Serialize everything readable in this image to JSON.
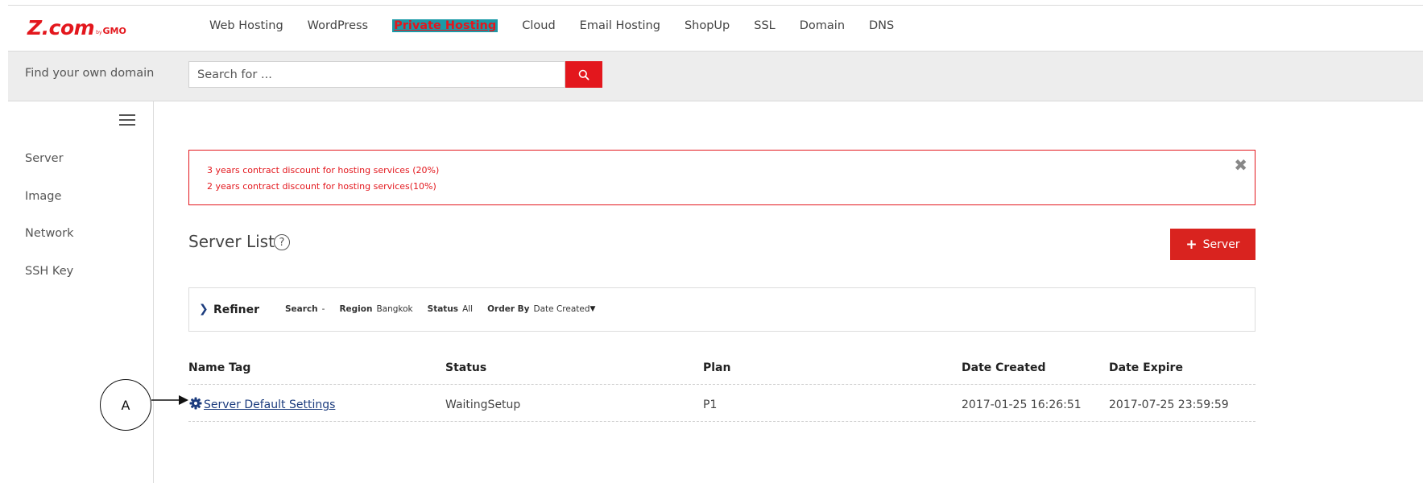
{
  "header": {
    "logo": {
      "main": "Z.com",
      "by": "by",
      "gmo": "GMO"
    },
    "nav": [
      {
        "label": "Web Hosting",
        "active": false
      },
      {
        "label": "WordPress",
        "active": false
      },
      {
        "label": "Private Hosting",
        "active": true
      },
      {
        "label": "Cloud",
        "active": false
      },
      {
        "label": "Email Hosting",
        "active": false
      },
      {
        "label": "ShopUp",
        "active": false
      },
      {
        "label": "SSL",
        "active": false
      },
      {
        "label": "Domain",
        "active": false
      },
      {
        "label": "DNS",
        "active": false
      }
    ]
  },
  "search": {
    "label": "Find your own domain",
    "placeholder": "Search for ..."
  },
  "sidebar": {
    "items": [
      {
        "label": "Server"
      },
      {
        "label": "Image"
      },
      {
        "label": "Network"
      },
      {
        "label": "SSH Key"
      }
    ]
  },
  "alert": {
    "lines": [
      "3 years contract discount for hosting services (20%)",
      "2 years contract discount for hosting services(10%)"
    ],
    "close_glyph": "✖"
  },
  "main": {
    "title": "Server List",
    "help_glyph": "?",
    "add_button": {
      "plus": "+",
      "label": "Server"
    }
  },
  "refiner": {
    "chevron": "❯",
    "title": "Refiner",
    "filters": [
      {
        "label": "Search",
        "value": "-"
      },
      {
        "label": "Region",
        "value": "Bangkok"
      },
      {
        "label": "Status",
        "value": "All"
      },
      {
        "label": "Order By",
        "value": "Date Created"
      }
    ],
    "caret": "▼"
  },
  "table": {
    "headers": [
      "Name Tag",
      "Status",
      "Plan",
      "Date Created",
      "Date Expire"
    ],
    "rows": [
      {
        "name": "Server Default Settings",
        "status": "WaitingSetup",
        "plan": "P1",
        "created": "2017-01-25 16:26:51",
        "expire": "2017-07-25 23:59:59"
      }
    ]
  },
  "annotation": {
    "label": "A"
  },
  "colors": {
    "brand_red": "#e3171d",
    "nav_active_bg": "#1a9aa8",
    "link_blue": "#1c3c7e"
  }
}
